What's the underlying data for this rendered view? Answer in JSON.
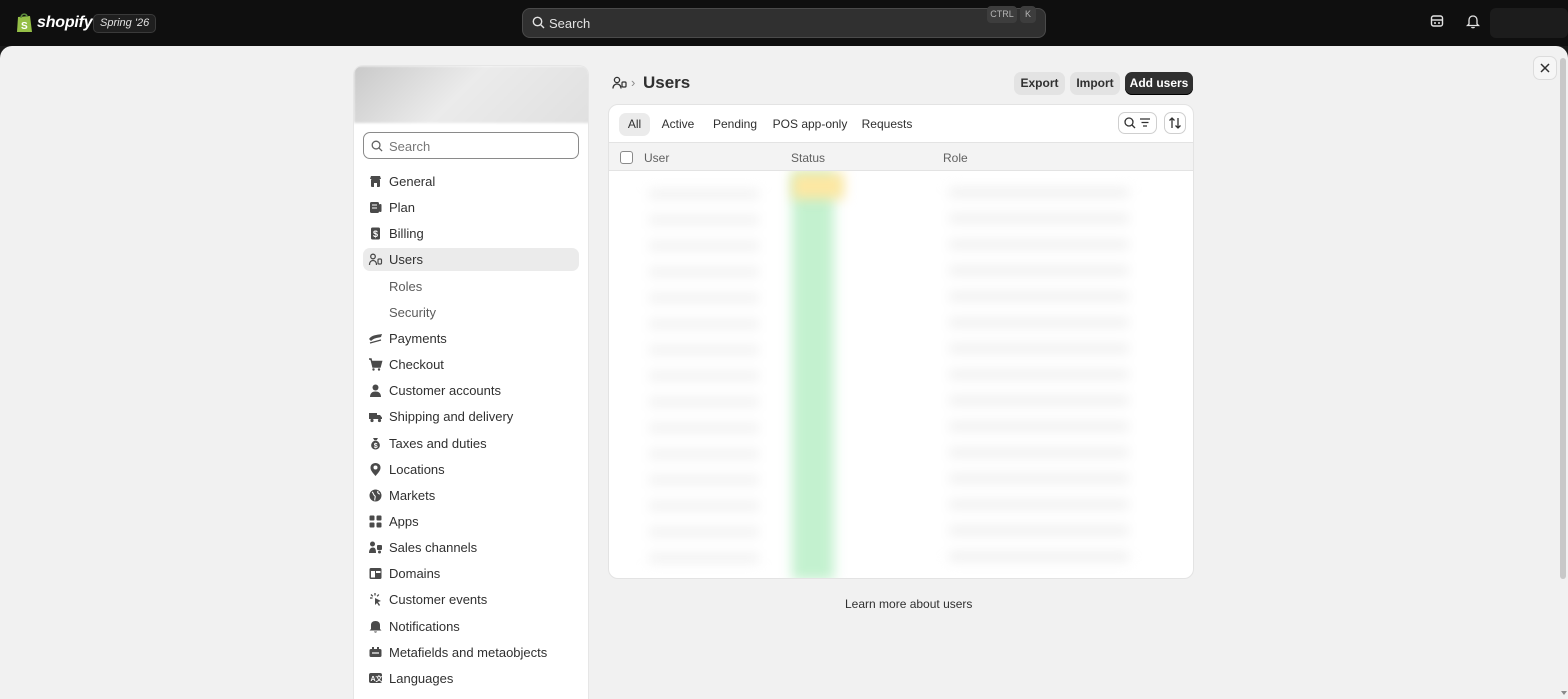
{
  "topbar": {
    "brand": "shopify",
    "release": "Spring '26",
    "search_placeholder": "Search",
    "shortcut_keys": [
      "CTRL",
      "K"
    ]
  },
  "sidebar": {
    "search_placeholder": "Search",
    "items": [
      {
        "label": "General",
        "icon": "store-icon"
      },
      {
        "label": "Plan",
        "icon": "plan-icon"
      },
      {
        "label": "Billing",
        "icon": "billing-icon"
      },
      {
        "label": "Users",
        "icon": "users-icon",
        "active": true
      },
      {
        "label": "Roles",
        "sub": true
      },
      {
        "label": "Security",
        "sub": true
      },
      {
        "label": "Payments",
        "icon": "payments-icon"
      },
      {
        "label": "Checkout",
        "icon": "cart-icon"
      },
      {
        "label": "Customer accounts",
        "icon": "person-icon"
      },
      {
        "label": "Shipping and delivery",
        "icon": "truck-icon"
      },
      {
        "label": "Taxes and duties",
        "icon": "money-bag-icon"
      },
      {
        "label": "Locations",
        "icon": "location-icon"
      },
      {
        "label": "Markets",
        "icon": "globe-icon"
      },
      {
        "label": "Apps",
        "icon": "apps-icon"
      },
      {
        "label": "Sales channels",
        "icon": "channels-icon"
      },
      {
        "label": "Domains",
        "icon": "domain-icon"
      },
      {
        "label": "Customer events",
        "icon": "cursor-icon"
      },
      {
        "label": "Notifications",
        "icon": "bell-icon"
      },
      {
        "label": "Metafields and metaobjects",
        "icon": "metafields-icon"
      },
      {
        "label": "Languages",
        "icon": "language-icon"
      }
    ]
  },
  "main": {
    "title": "Users",
    "buttons": {
      "export": "Export",
      "import": "Import",
      "add": "Add users"
    },
    "tabs": [
      "All",
      "Active",
      "Pending",
      "POS app-only",
      "Requests"
    ],
    "active_tab": "All",
    "columns": [
      "User",
      "Status",
      "Role"
    ],
    "footer_link": "Learn more about users"
  },
  "colors": {
    "primary": "#303030",
    "status_active": "#b4f0c4",
    "status_pending": "#ffe48a"
  }
}
